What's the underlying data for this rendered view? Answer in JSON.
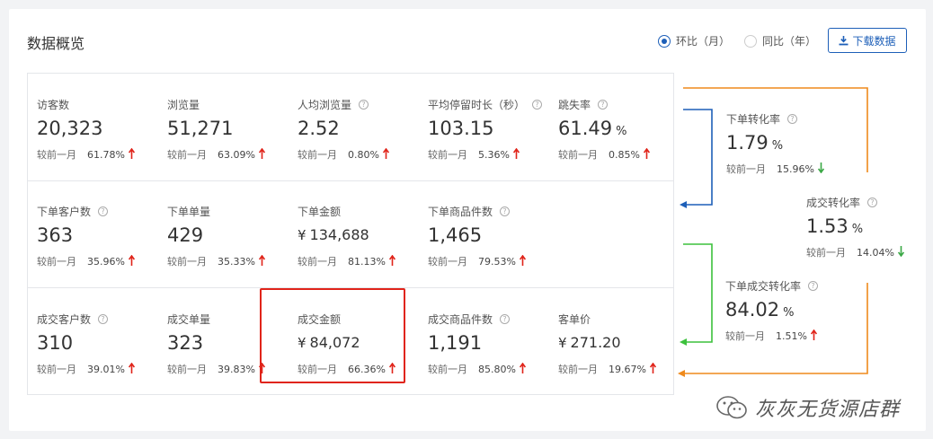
{
  "header": {
    "title": "数据概览",
    "radio_mom": "环比（月）",
    "radio_yoy": "同比（年）",
    "download_label": "下载数据"
  },
  "metrics": {
    "row1": [
      {
        "label": "访客数",
        "value": "20,323",
        "compare": "较前一月",
        "pct": "61.78%",
        "trend": "up",
        "help": false
      },
      {
        "label": "浏览量",
        "value": "51,271",
        "compare": "较前一月",
        "pct": "63.09%",
        "trend": "up",
        "help": false
      },
      {
        "label": "人均浏览量",
        "value": "2.52",
        "compare": "较前一月",
        "pct": "0.80%",
        "trend": "up",
        "help": true
      },
      {
        "label": "平均停留时长（秒）",
        "value": "103.15",
        "compare": "较前一月",
        "pct": "5.36%",
        "trend": "up",
        "help": true
      },
      {
        "label": "跳失率",
        "value": "61.49",
        "unit": "%",
        "compare": "较前一月",
        "pct": "0.85%",
        "trend": "up",
        "help": true
      }
    ],
    "row2": [
      {
        "label": "下单客户数",
        "value": "363",
        "compare": "较前一月",
        "pct": "35.96%",
        "trend": "up",
        "help": true
      },
      {
        "label": "下单单量",
        "value": "429",
        "compare": "较前一月",
        "pct": "35.33%",
        "trend": "up",
        "help": false
      },
      {
        "label": "下单金额",
        "value": "134,688",
        "currency": "¥",
        "compare": "较前一月",
        "pct": "81.13%",
        "trend": "up",
        "help": false
      },
      {
        "label": "下单商品件数",
        "value": "1,465",
        "compare": "较前一月",
        "pct": "79.53%",
        "trend": "up",
        "help": true
      }
    ],
    "row3": [
      {
        "label": "成交客户数",
        "value": "310",
        "compare": "较前一月",
        "pct": "39.01%",
        "trend": "up",
        "help": true
      },
      {
        "label": "成交单量",
        "value": "323",
        "compare": "较前一月",
        "pct": "39.83%",
        "trend": "up",
        "help": false
      },
      {
        "label": "成交金额",
        "value": "84,072",
        "currency": "¥",
        "compare": "较前一月",
        "pct": "66.36%",
        "trend": "up",
        "help": false
      },
      {
        "label": "成交商品件数",
        "value": "1,191",
        "compare": "较前一月",
        "pct": "85.80%",
        "trend": "up",
        "help": true
      },
      {
        "label": "客单价",
        "value": "271.20",
        "currency": "¥",
        "compare": "较前一月",
        "pct": "19.67%",
        "trend": "up",
        "help": false
      }
    ]
  },
  "conversion": {
    "order_rate": {
      "label": "下单转化率",
      "value": "1.79",
      "unit": "%",
      "compare": "较前一月",
      "pct": "15.96%",
      "trend": "down"
    },
    "deal_rate": {
      "label": "成交转化率",
      "value": "1.53",
      "unit": "%",
      "compare": "较前一月",
      "pct": "14.04%",
      "trend": "down"
    },
    "order_deal_rate": {
      "label": "下单成交转化率",
      "value": "84.02",
      "unit": "%",
      "compare": "较前一月",
      "pct": "1.51%",
      "trend": "up"
    }
  },
  "watermark": "灰灰无货源店群",
  "colors": {
    "up": "#e0241a",
    "down": "#3aa845",
    "primary": "#1d5fb8",
    "flow_orange": "#ef8a1c",
    "flow_blue": "#1d5fb8",
    "flow_green": "#3cc13c",
    "highlight": "#e0241a"
  }
}
